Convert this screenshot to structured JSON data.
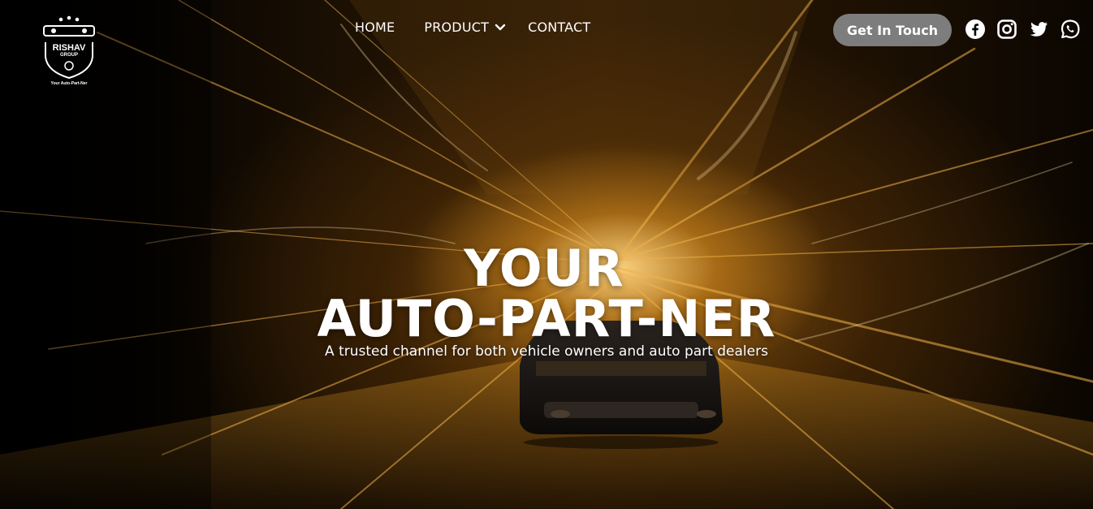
{
  "brand": {
    "logo_name": "RISHAV",
    "logo_group": "GROUP",
    "tagline": "Your Auto-Part-Ner"
  },
  "nav": {
    "items": [
      {
        "label": "HOME"
      },
      {
        "label": "PRODUCT",
        "icon": "chevron-down-icon"
      },
      {
        "label": "CONTACT"
      }
    ]
  },
  "cta": {
    "label": "Get In Touch"
  },
  "socials": [
    "facebook-icon",
    "instagram-icon",
    "twitter-icon",
    "whatsapp-icon"
  ],
  "hero": {
    "title_line1": "YOUR",
    "title_line2": "AUTO-PART-NER",
    "subtitle": "A trusted channel for both vehicle owners and auto part dealers"
  },
  "colors": {
    "accent": "#d99a2b",
    "cta_bg": "#7d7d7d",
    "background": "#000000"
  }
}
